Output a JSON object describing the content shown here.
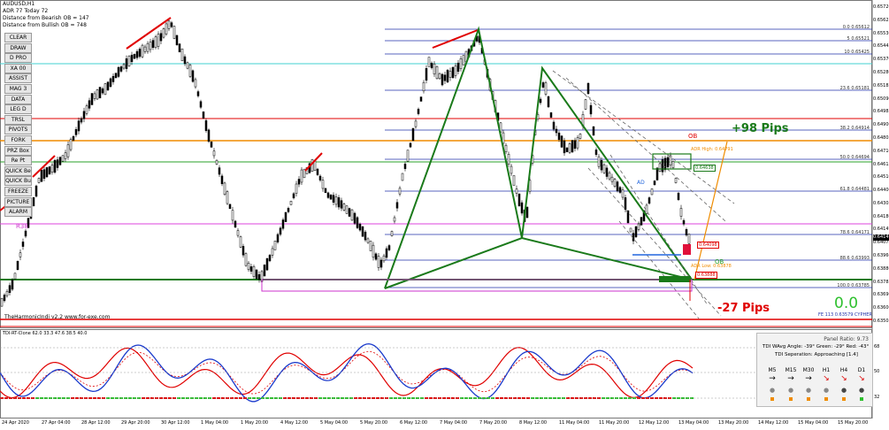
{
  "header": {
    "symbol": "AUDUSD,H1",
    "adr_line": "ADR 77  Today 72",
    "dist_bear": "Distance from Bearish OB = 147",
    "dist_bull": "Distance from Bullish OB = 748"
  },
  "toolbar": {
    "buttons": [
      "CLEAR",
      "DRAW",
      "D PRO",
      "XA 00",
      "ASSIST",
      "MAG 3",
      "DATA",
      "LEG D",
      "TRSL",
      "PIVOTS",
      "FORK",
      "PRZ Box",
      "Re Pt",
      "QUICK Be",
      "QUICK Bu",
      "FREEZE",
      "PICTURE",
      "ALARM"
    ]
  },
  "labels": {
    "watermark": "TheHarmonicIndi v2.2 www.for-exe.com",
    "r38": "R38",
    "ob_top": "OB",
    "ob_bottom": "OB",
    "adr_high": "ADR High: 0.64791",
    "adr_low": "ADR Low: 0.63878",
    "ad": "AD",
    "pips_up": "+98 Pips",
    "pips_down": "-27 Pips",
    "zero": "0.0",
    "fe_line": "FE 113 0.63579 CYPHER",
    "bull_box": "0.64098",
    "mid_box": "0.64638",
    "low_box": "0.63888"
  },
  "fib": [
    {
      "text": "0.0 0.65612"
    },
    {
      "text": "5 0.65521"
    },
    {
      "text": "10 0.65425"
    },
    {
      "text": "23.6 0.65181"
    },
    {
      "text": "38.2 0.64914"
    },
    {
      "text": "50.0 0.64694"
    },
    {
      "text": "61.8 0.64481"
    },
    {
      "text": "78.6 0.64171"
    },
    {
      "text": "88.6 0.63993"
    },
    {
      "text": "100.0 0.63785"
    }
  ],
  "price_axis": [
    "0.65720",
    "0.65625",
    "0.65530",
    "0.65445",
    "0.65370",
    "0.65280",
    "0.65185",
    "0.65090",
    "0.64985",
    "0.64900",
    "0.64805",
    "0.64710",
    "0.64615",
    "0.64510",
    "0.64400",
    "0.64305",
    "0.64180",
    "0.64149",
    "0.64075",
    "0.63960",
    "0.63880",
    "0.63785",
    "0.63690",
    "0.63600",
    "0.63505"
  ],
  "price_current": "0.64149",
  "time_axis": [
    "24 Apr 2020",
    "27 Apr 04:00",
    "28 Apr 12:00",
    "29 Apr 20:00",
    "30 Apr 12:00",
    "1 May 04:00",
    "1 May 20:00",
    "4 May 12:00",
    "5 May 04:00",
    "5 May 20:00",
    "6 May 12:00",
    "7 May 04:00",
    "7 May 20:00",
    "8 May 12:00",
    "11 May 04:00",
    "11 May 20:00",
    "12 May 12:00",
    "13 May 04:00",
    "13 May 20:00",
    "14 May 12:00",
    "15 May 04:00",
    "15 May 20:00"
  ],
  "indicator": {
    "title": "TDI-RT-Clone 62.0 33.3 47.6 38.5 40.0",
    "levels": [
      "68",
      "50",
      "32"
    ]
  },
  "tdi_panel": {
    "panel_ratio": "Panel Ratio: 9.73",
    "wavg": "TDI WAvg Angle: -39°  Green: -29°  Red: -43°",
    "separation": "TDI Seperation: Approaching [1.4]",
    "timeframes": [
      "M5",
      "M15",
      "M30",
      "H1",
      "H4",
      "D1"
    ],
    "arrows": [
      "→",
      "→",
      "→",
      "↘",
      "↘",
      "↘"
    ]
  },
  "colors": {
    "bull": "#1a7a1a",
    "bear": "#e00000",
    "fib": "#2233aa",
    "orange": "#f08c00",
    "cyan": "#40d0d0",
    "magenta": "#cc33cc"
  }
}
